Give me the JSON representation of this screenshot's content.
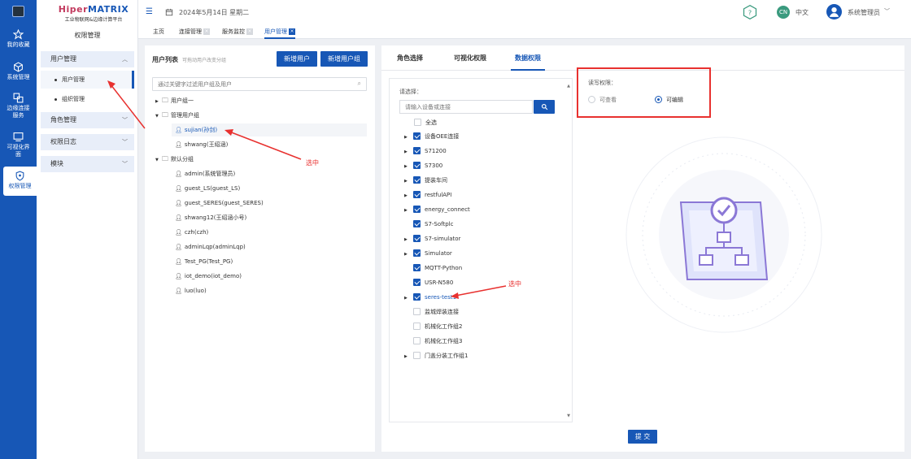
{
  "brand": {
    "name_a": "Hiper",
    "name_b": "MATRIX",
    "subtitle": "工业物联网&边缘计算平台"
  },
  "rail": [
    {
      "label": "我的收藏",
      "icon": "star-icon"
    },
    {
      "label": "系统管理",
      "icon": "cube-icon"
    },
    {
      "label": "边缘连接服务",
      "icon": "link-icon"
    },
    {
      "label": "可视化界面",
      "icon": "screen-icon"
    },
    {
      "label": "权限管理",
      "icon": "shield-icon"
    }
  ],
  "sidebar": {
    "title": "权限管理",
    "sections": [
      "用户管理",
      "角色管理",
      "权限日志",
      "模块"
    ],
    "sub_items": [
      "用户管理",
      "组织管理"
    ]
  },
  "header": {
    "date": "2024年5月14日 星期二",
    "lang_badge": "CN",
    "lang": "中文",
    "user": "系统管理员"
  },
  "tabs": [
    "主页",
    "连接管理",
    "服务监控",
    "用户管理"
  ],
  "users": {
    "title": "用户列表",
    "hint": "可拖动用户改变分组",
    "add_user": "新增用户",
    "add_group": "新增用户组",
    "search_placeholder": "通过关键字过滤用户组及用户",
    "groups": [
      {
        "name": "用户组一",
        "members": []
      },
      {
        "name": "管理用户组",
        "members": [
          "sujian(孙剑)",
          "shwang(王绍涵)"
        ]
      },
      {
        "name": "默认分组",
        "members": [
          "admin(系统管理员)",
          "guest_LS(guest_LS)",
          "guest_SERES(guest_SERES)",
          "shwang12(王绍涵小号)",
          "czh(czh)",
          "adminLqp(adminLqp)",
          "Test_PG(Test_PG)",
          "iot_demo(iot_demo)",
          "luo(luo)"
        ]
      }
    ]
  },
  "perm": {
    "tabs": [
      "角色选择",
      "可视化权限",
      "数据权限"
    ],
    "select_label": "请选择：",
    "search_placeholder": "请输入设备或连接",
    "select_all": "全选",
    "items": [
      {
        "label": "设备OEE连接",
        "checked": true,
        "expandable": true
      },
      {
        "label": "S71200",
        "checked": true,
        "expandable": true
      },
      {
        "label": "S7300",
        "checked": true,
        "expandable": true
      },
      {
        "label": "提装车间",
        "checked": true,
        "expandable": true
      },
      {
        "label": "restfulAPI",
        "checked": true,
        "expandable": true
      },
      {
        "label": "energy_connect",
        "checked": true,
        "expandable": true
      },
      {
        "label": "S7-Softplc",
        "checked": true,
        "expandable": false
      },
      {
        "label": "S7-simulator",
        "checked": true,
        "expandable": true
      },
      {
        "label": "Simulator",
        "checked": true,
        "expandable": true
      },
      {
        "label": "MQTT-Python",
        "checked": true,
        "expandable": false
      },
      {
        "label": "USR-N580",
        "checked": true,
        "expandable": false
      },
      {
        "label": "seres-test1",
        "checked": true,
        "expandable": true
      },
      {
        "label": "监城焊装连接",
        "checked": false,
        "expandable": false
      },
      {
        "label": "机械化工作组2",
        "checked": false,
        "expandable": false
      },
      {
        "label": "机械化工作组3",
        "checked": false,
        "expandable": false
      },
      {
        "label": "门盖分装工作组1",
        "checked": false,
        "expandable": true
      }
    ],
    "rw_label": "读写权限：",
    "rw_options": [
      "可查看",
      "可编辑"
    ],
    "rw_selected": "可编辑",
    "submit": "提 交"
  },
  "annotations": {
    "select_note_1": "选中",
    "select_note_2": "选中"
  },
  "colors": {
    "primary": "#1757b6",
    "annotation": "#e8312f",
    "brand_red": "#c23a5e"
  }
}
